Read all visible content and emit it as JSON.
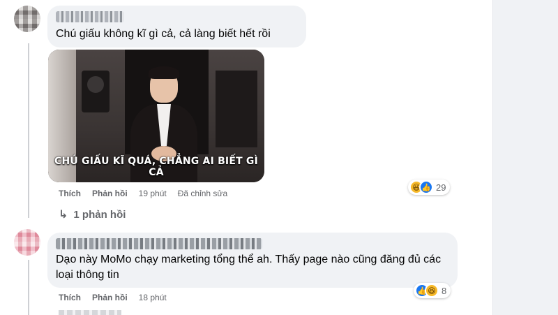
{
  "comments": [
    {
      "text": "Chú giấu không kĩ gì cả, cả làng biết hết rồi",
      "gif_caption": "CHÚ GIẤU KĨ QUÁ, CHẲNG AI BIẾT GÌ CẢ",
      "actions": {
        "like": "Thích",
        "reply": "Phản hồi",
        "time": "19 phút",
        "edited": "Đã chỉnh sửa"
      },
      "reactions": {
        "icons": [
          "haha-icon",
          "like-icon"
        ],
        "count": "29"
      },
      "view_replies": "1 phản hồi"
    },
    {
      "text": "Dạo này MoMo chạy marketing tổng thể ah. Thấy page nào cũng đăng đủ các loại thông tin",
      "actions": {
        "like": "Thích",
        "reply": "Phản hồi",
        "time": "18 phút"
      },
      "reactions": {
        "icons": [
          "like-icon",
          "haha-icon"
        ],
        "count": "8"
      }
    }
  ],
  "colors": {
    "bubble": "#f0f2f5",
    "meta_text": "#65676b",
    "like_blue": "#1877f2",
    "haha_yellow": "#f7b928"
  }
}
